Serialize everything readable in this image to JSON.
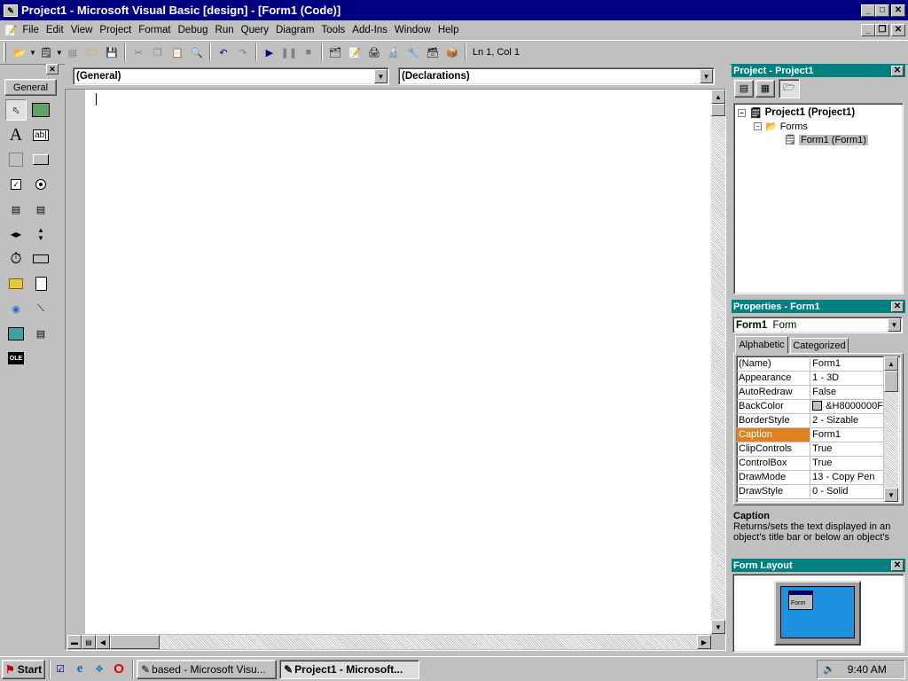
{
  "window": {
    "title": "Project1 - Microsoft Visual Basic [design] - [Form1 (Code)]",
    "controls": [
      "_",
      "□",
      "✕"
    ],
    "mdi_controls": [
      "_",
      "❐",
      "✕"
    ]
  },
  "menu": [
    "File",
    "Edit",
    "View",
    "Project",
    "Format",
    "Debug",
    "Run",
    "Query",
    "Diagram",
    "Tools",
    "Add-Ins",
    "Window",
    "Help"
  ],
  "toolbar": {
    "position": "Ln 1, Col 1",
    "icons": [
      "add-project-icon",
      "add-form-icon",
      "menu-editor-icon",
      "open-icon",
      "save-icon",
      "cut-icon",
      "copy-icon",
      "paste-icon",
      "find-icon",
      "undo-icon",
      "redo-icon",
      "start-icon",
      "break-icon",
      "end-icon",
      "project-explorer-icon",
      "properties-icon",
      "form-layout-icon",
      "object-browser-icon",
      "toolbox-icon",
      "data-view-icon",
      "component-manager-icon"
    ]
  },
  "toolbox": {
    "tab": "General",
    "tools": [
      "pointer",
      "picturebox",
      "label",
      "textbox",
      "frame",
      "commandbutton",
      "checkbox",
      "optionbutton",
      "combobox",
      "listbox",
      "hscrollbar",
      "vscrollbar",
      "timer",
      "drivelistbox",
      "dirlistbox",
      "filelistbox",
      "shape",
      "line",
      "image",
      "data",
      "ole"
    ]
  },
  "code": {
    "object_dropdown": "(General)",
    "proc_dropdown": "(Declarations)"
  },
  "project": {
    "title": "Project - Project1",
    "tree": {
      "root": "Project1 (Project1)",
      "folder": "Forms",
      "item": "Form1 (Form1)"
    }
  },
  "properties": {
    "title": "Properties - Form1",
    "object_name": "Form1",
    "object_type": "Form",
    "tabs": [
      "Alphabetic",
      "Categorized"
    ],
    "rows": [
      {
        "name": "(Name)",
        "value": "Form1"
      },
      {
        "name": "Appearance",
        "value": "1 - 3D"
      },
      {
        "name": "AutoRedraw",
        "value": "False"
      },
      {
        "name": "BackColor",
        "value": "&H8000000F"
      },
      {
        "name": "BorderStyle",
        "value": "2 - Sizable"
      },
      {
        "name": "Caption",
        "value": "Form1"
      },
      {
        "name": "ClipControls",
        "value": "True"
      },
      {
        "name": "ControlBox",
        "value": "True"
      },
      {
        "name": "DrawMode",
        "value": "13 - Copy Pen"
      },
      {
        "name": "DrawStyle",
        "value": "0 - Solid"
      }
    ],
    "selected_row": 5,
    "desc_title": "Caption",
    "desc_text": "Returns/sets the text displayed in an object's title bar or below an object's"
  },
  "form_layout": {
    "title": "Form Layout",
    "thumb_label": "Form"
  },
  "taskbar": {
    "start": "Start",
    "tasks": [
      "based - Microsoft Visu...",
      "Project1 - Microsoft..."
    ],
    "time": "9:40 AM"
  },
  "colors": {
    "title": "#000080",
    "panel_title": "#008080",
    "selection": "#e08020",
    "monitor": "#1e90e0"
  }
}
